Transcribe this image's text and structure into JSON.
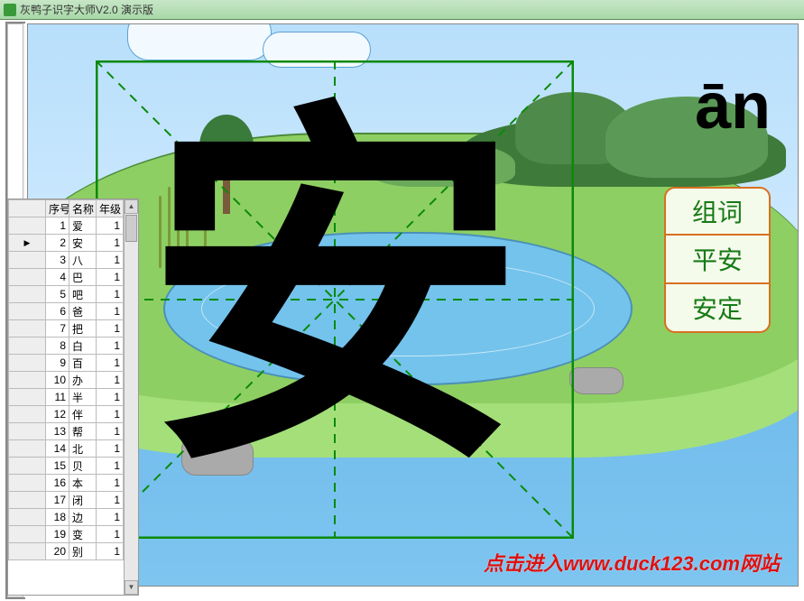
{
  "window": {
    "title": "灰鸭子识字大师V2.0 演示版"
  },
  "table": {
    "headers": {
      "idx": "序号",
      "name": "名称",
      "grade": "年级"
    },
    "selected_row": 2,
    "rows": [
      {
        "idx": 1,
        "name": "爱",
        "grade": 1
      },
      {
        "idx": 2,
        "name": "安",
        "grade": 1
      },
      {
        "idx": 3,
        "name": "八",
        "grade": 1
      },
      {
        "idx": 4,
        "name": "巴",
        "grade": 1
      },
      {
        "idx": 5,
        "name": "吧",
        "grade": 1
      },
      {
        "idx": 6,
        "name": "爸",
        "grade": 1
      },
      {
        "idx": 7,
        "name": "把",
        "grade": 1
      },
      {
        "idx": 8,
        "name": "白",
        "grade": 1
      },
      {
        "idx": 9,
        "name": "百",
        "grade": 1
      },
      {
        "idx": 10,
        "name": "办",
        "grade": 1
      },
      {
        "idx": 11,
        "name": "半",
        "grade": 1
      },
      {
        "idx": 12,
        "name": "伴",
        "grade": 1
      },
      {
        "idx": 13,
        "name": "帮",
        "grade": 1
      },
      {
        "idx": 14,
        "name": "北",
        "grade": 1
      },
      {
        "idx": 15,
        "name": "贝",
        "grade": 1
      },
      {
        "idx": 16,
        "name": "本",
        "grade": 1
      },
      {
        "idx": 17,
        "name": "闭",
        "grade": 1
      },
      {
        "idx": 18,
        "name": "边",
        "grade": 1
      },
      {
        "idx": 19,
        "name": "变",
        "grade": 1
      },
      {
        "idx": 20,
        "name": "别",
        "grade": 1
      }
    ]
  },
  "character": {
    "glyph": "安",
    "pinyin": "ān"
  },
  "words": {
    "header": "组词",
    "w1": "平安",
    "w2": "安定"
  },
  "link": {
    "text": "点击进入www.duck123.com网站"
  }
}
